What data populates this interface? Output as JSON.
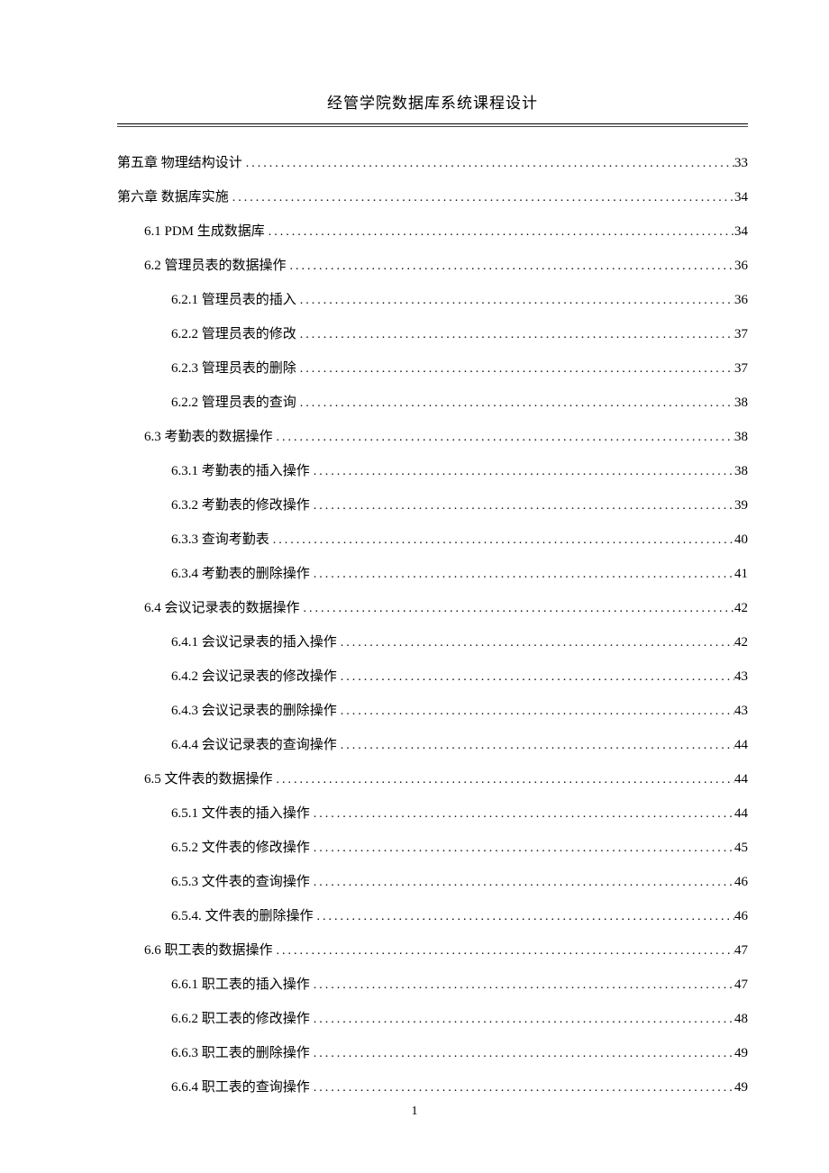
{
  "header": "经管学院数据库系统课程设计",
  "page_number": "1",
  "toc": [
    {
      "level": 0,
      "title": "第五章 物理结构设计",
      "page": "33"
    },
    {
      "level": 0,
      "title": "第六章 数据库实施",
      "page": "34"
    },
    {
      "level": 1,
      "title": "6.1 PDM 生成数据库",
      "page": "34"
    },
    {
      "level": 1,
      "title": "6.2  管理员表的数据操作",
      "page": "36"
    },
    {
      "level": 2,
      "title": "6.2.1 管理员表的插入",
      "page": "36"
    },
    {
      "level": 2,
      "title": "6.2.2 管理员表的修改",
      "page": "37"
    },
    {
      "level": 2,
      "title": "6.2.3 管理员表的删除",
      "page": "37"
    },
    {
      "level": 2,
      "title": "6.2.2 管理员表的查询",
      "page": "38"
    },
    {
      "level": 1,
      "title": "6.3 考勤表的数据操作",
      "page": "38"
    },
    {
      "level": 2,
      "title": "6.3.1 考勤表的插入操作",
      "page": "38"
    },
    {
      "level": 2,
      "title": "6.3.2 考勤表的修改操作",
      "page": "39"
    },
    {
      "level": 2,
      "title": "6.3.3 查询考勤表",
      "page": "40"
    },
    {
      "level": 2,
      "title": "6.3.4 考勤表的删除操作",
      "page": "41"
    },
    {
      "level": 1,
      "title": "6.4 会议记录表的数据操作",
      "page": "42"
    },
    {
      "level": 2,
      "title": "6.4.1 会议记录表的插入操作",
      "page": "42"
    },
    {
      "level": 2,
      "title": "6.4.2 会议记录表的修改操作",
      "page": "43"
    },
    {
      "level": 2,
      "title": "6.4.3 会议记录表的删除操作",
      "page": "43"
    },
    {
      "level": 2,
      "title": "6.4.4 会议记录表的查询操作",
      "page": "44"
    },
    {
      "level": 1,
      "title": "6.5 文件表的数据操作",
      "page": "44"
    },
    {
      "level": 2,
      "title": "6.5.1 文件表的插入操作",
      "page": "44"
    },
    {
      "level": 2,
      "title": "6.5.2 文件表的修改操作",
      "page": "45"
    },
    {
      "level": 2,
      "title": "6.5.3 文件表的查询操作",
      "page": "46"
    },
    {
      "level": 2,
      "title": "6.5.4. 文件表的删除操作",
      "page": "46"
    },
    {
      "level": 1,
      "title": "6.6 职工表的数据操作",
      "page": "47"
    },
    {
      "level": 2,
      "title": "6.6.1 职工表的插入操作",
      "page": "47"
    },
    {
      "level": 2,
      "title": "6.6.2 职工表的修改操作",
      "page": "48"
    },
    {
      "level": 2,
      "title": "6.6.3 职工表的删除操作",
      "page": "49"
    },
    {
      "level": 2,
      "title": "6.6.4 职工表的查询操作",
      "page": "49"
    }
  ]
}
